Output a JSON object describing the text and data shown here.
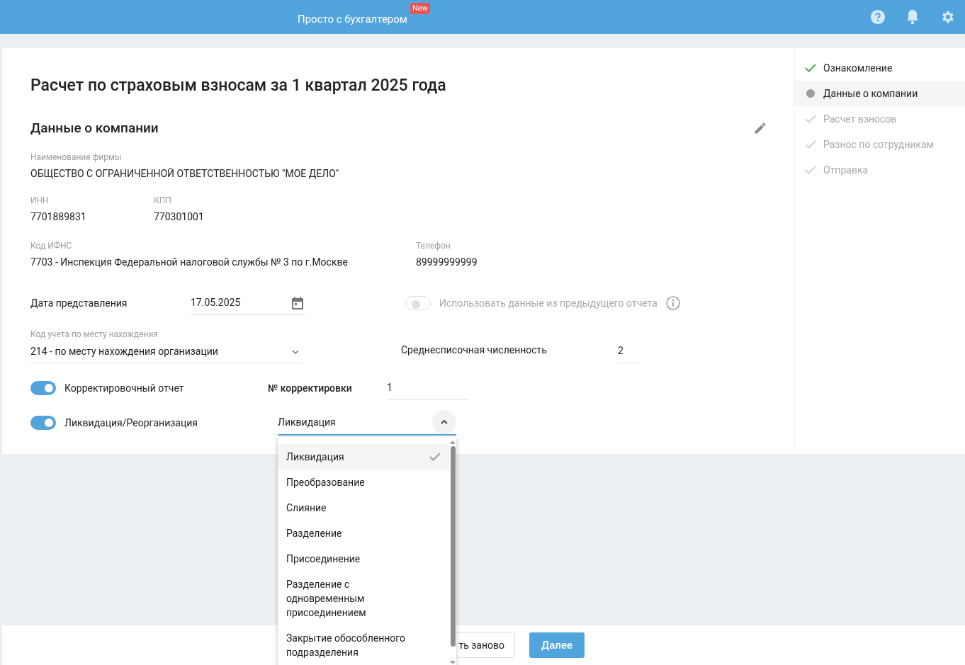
{
  "header": {
    "title": "Просто с бухгалтером",
    "badge": "New"
  },
  "page": {
    "title": "Расчет по страховым взносам за 1 квартал 2025 года",
    "section_title": "Данные о компании"
  },
  "company": {
    "name_label": "Наименование фирмы",
    "name": "ОБЩЕСТВО С ОГРАНИЧЕННОЙ ОТВЕТСТВЕННОСТЬЮ \"МОЕ ДЕЛО\"",
    "inn_label": "ИНН",
    "inn": "7701889831",
    "kpp_label": "КПП",
    "kpp": "770301001",
    "ifns_label": "Код ИФНС",
    "ifns": "7703 - Инспекция Федеральной налоговой службы № 3 по г.Москве",
    "phone_label": "Телефон",
    "phone": "89999999999"
  },
  "date": {
    "label": "Дата представления",
    "value": "17.05.2025"
  },
  "use_previous": {
    "label": "Использовать данные из предыдущего отчета",
    "on": false,
    "disabled": true
  },
  "location_code": {
    "label": "Код учета по месту нахождения",
    "value": "214 - по месту нахождения организации"
  },
  "headcount": {
    "label": "Среднесписочная численность",
    "value": "2"
  },
  "correction": {
    "label": "Корректировочный отчет",
    "on": true,
    "number_label": "№ корректировки",
    "number": "1"
  },
  "liquidation": {
    "label": "Ликвидация/Реорганизация",
    "on": true,
    "value": "Ликвидация",
    "expanded": true,
    "options": [
      {
        "label": "Ликвидация",
        "selected": true
      },
      {
        "label": "Преобразование",
        "selected": false
      },
      {
        "label": "Слияние",
        "selected": false
      },
      {
        "label": "Разделение",
        "selected": false
      },
      {
        "label": "Присоединение",
        "selected": false
      },
      {
        "label": "Разделение с одновременным присоединением",
        "selected": false
      },
      {
        "label": "Закрытие обособленного подразделения",
        "selected": false
      }
    ]
  },
  "steps": [
    {
      "label": "Ознакомление",
      "kind": "done"
    },
    {
      "label": "Данные о компании",
      "kind": "current"
    },
    {
      "label": "Расчет взносов",
      "kind": "pending"
    },
    {
      "label": "Разнос по сотрудникам",
      "kind": "pending"
    },
    {
      "label": "Отправка",
      "kind": "pending"
    }
  ],
  "footer": {
    "secondary_button": "ть заново",
    "primary_button": "Далее"
  }
}
